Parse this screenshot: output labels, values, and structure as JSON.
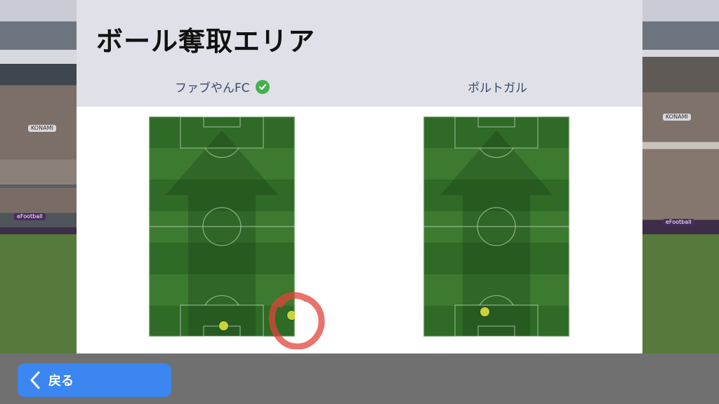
{
  "screen": {
    "title": "ボール奪取エリア"
  },
  "teams": {
    "home": {
      "name": "ファブやんFC",
      "selected": true
    },
    "away": {
      "name": "ポルトガル"
    }
  },
  "background": {
    "adboard_text_1": "eFootball",
    "adboard_text_2": "eFootball",
    "adboard_text_3": "eFootball",
    "banner_left": "KONAMI",
    "banner_right": "KONAMI"
  },
  "back_button": {
    "label": "戻る"
  },
  "icons": {
    "check": "check-circle-icon",
    "back": "chevron-left-icon",
    "arrow": "attack-direction-arrow-icon"
  },
  "colors": {
    "panel_header": "#dfe0e8",
    "team_text": "#3b4a66",
    "check": "#43b24b",
    "ball_marker": "#c8d43a",
    "back_button": "#3b86f0",
    "annotation": "#e0443c"
  }
}
